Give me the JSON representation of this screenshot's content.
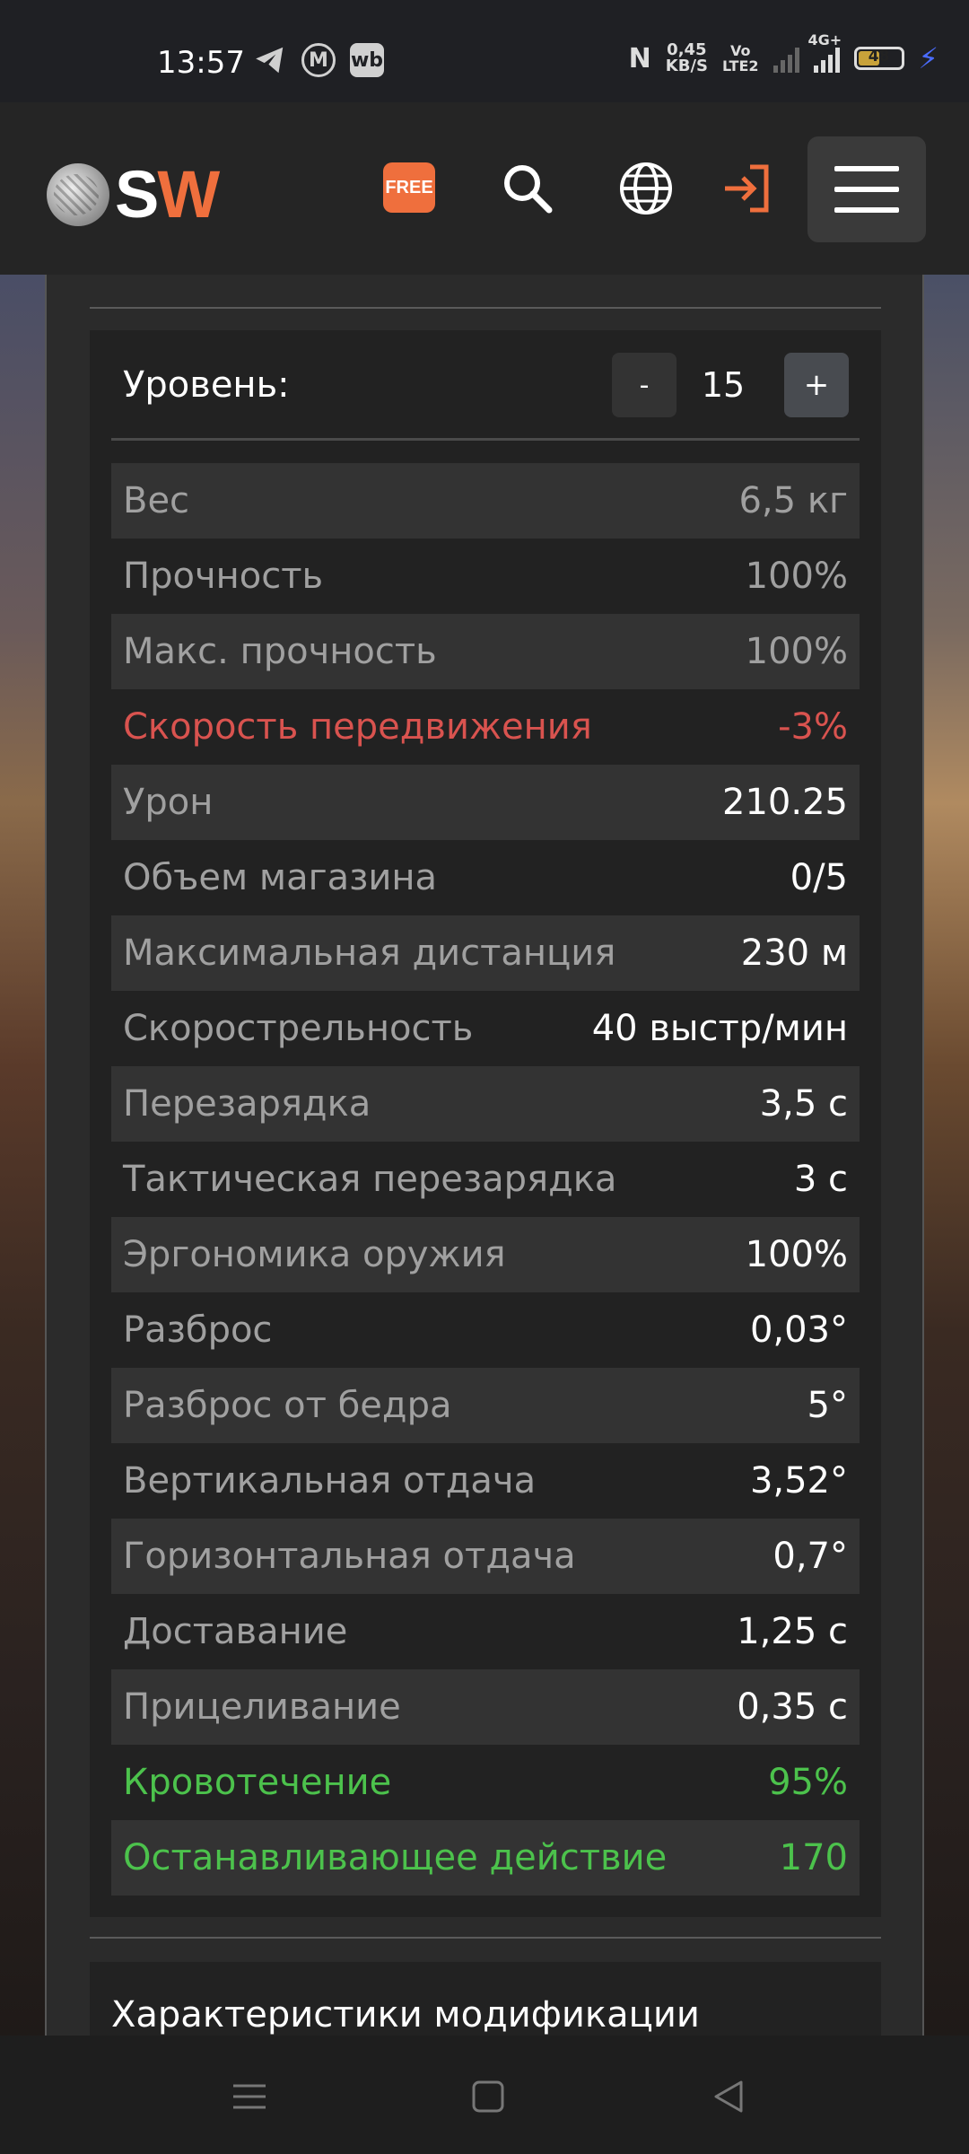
{
  "status_bar": {
    "time": "13:57",
    "apps": [
      "telegram-icon",
      "m-icon",
      "wb"
    ],
    "nfc": "N",
    "speed_value": "0,45",
    "speed_unit": "KB/S",
    "volte_line1": "Vo",
    "volte_line2": "LTE2",
    "network": "4G+",
    "battery": "48",
    "charging": true
  },
  "header": {
    "logo_s": "S",
    "logo_w": "W",
    "free_badge": "FREE",
    "accent_color": "#ef6f3d"
  },
  "level": {
    "label": "Уровень:",
    "minus": "-",
    "value": "15",
    "plus": "+"
  },
  "stats": [
    {
      "name": "Вес",
      "value": "6,5 кг",
      "style": "muted"
    },
    {
      "name": "Прочность",
      "value": "100%",
      "style": "muted"
    },
    {
      "name": "Макс. прочность",
      "value": "100%",
      "style": "muted"
    },
    {
      "name": "Скорость передвижения",
      "value": "-3%",
      "style": "red"
    },
    {
      "name": "Урон",
      "value": "210.25",
      "style": ""
    },
    {
      "name": "Объем магазина",
      "value": "0/5",
      "style": ""
    },
    {
      "name": "Максимальная дистанция",
      "value": "230 м",
      "style": ""
    },
    {
      "name": "Скорострельность",
      "value": "40 выстр/мин",
      "style": ""
    },
    {
      "name": "Перезарядка",
      "value": "3,5 с",
      "style": ""
    },
    {
      "name": "Тактическая перезарядка",
      "value": "3 с",
      "style": ""
    },
    {
      "name": "Эргономика оружия",
      "value": "100%",
      "style": ""
    },
    {
      "name": "Разброс",
      "value": "0,03°",
      "style": ""
    },
    {
      "name": "Разброс от бедра",
      "value": "5°",
      "style": ""
    },
    {
      "name": "Вертикальная отдача",
      "value": "3,52°",
      "style": ""
    },
    {
      "name": "Горизонтальная отдача",
      "value": "0,7°",
      "style": ""
    },
    {
      "name": "Доставание",
      "value": "1,25 с",
      "style": ""
    },
    {
      "name": "Прицеливание",
      "value": "0,35 с",
      "style": ""
    },
    {
      "name": "Кровотечение",
      "value": "95%",
      "style": "green"
    },
    {
      "name": "Останавливающее действие",
      "value": "170",
      "style": "green"
    }
  ],
  "modification": {
    "title": "Характеристики модификации"
  },
  "colors": {
    "red": "#d9534f",
    "green": "#4cc24c"
  }
}
